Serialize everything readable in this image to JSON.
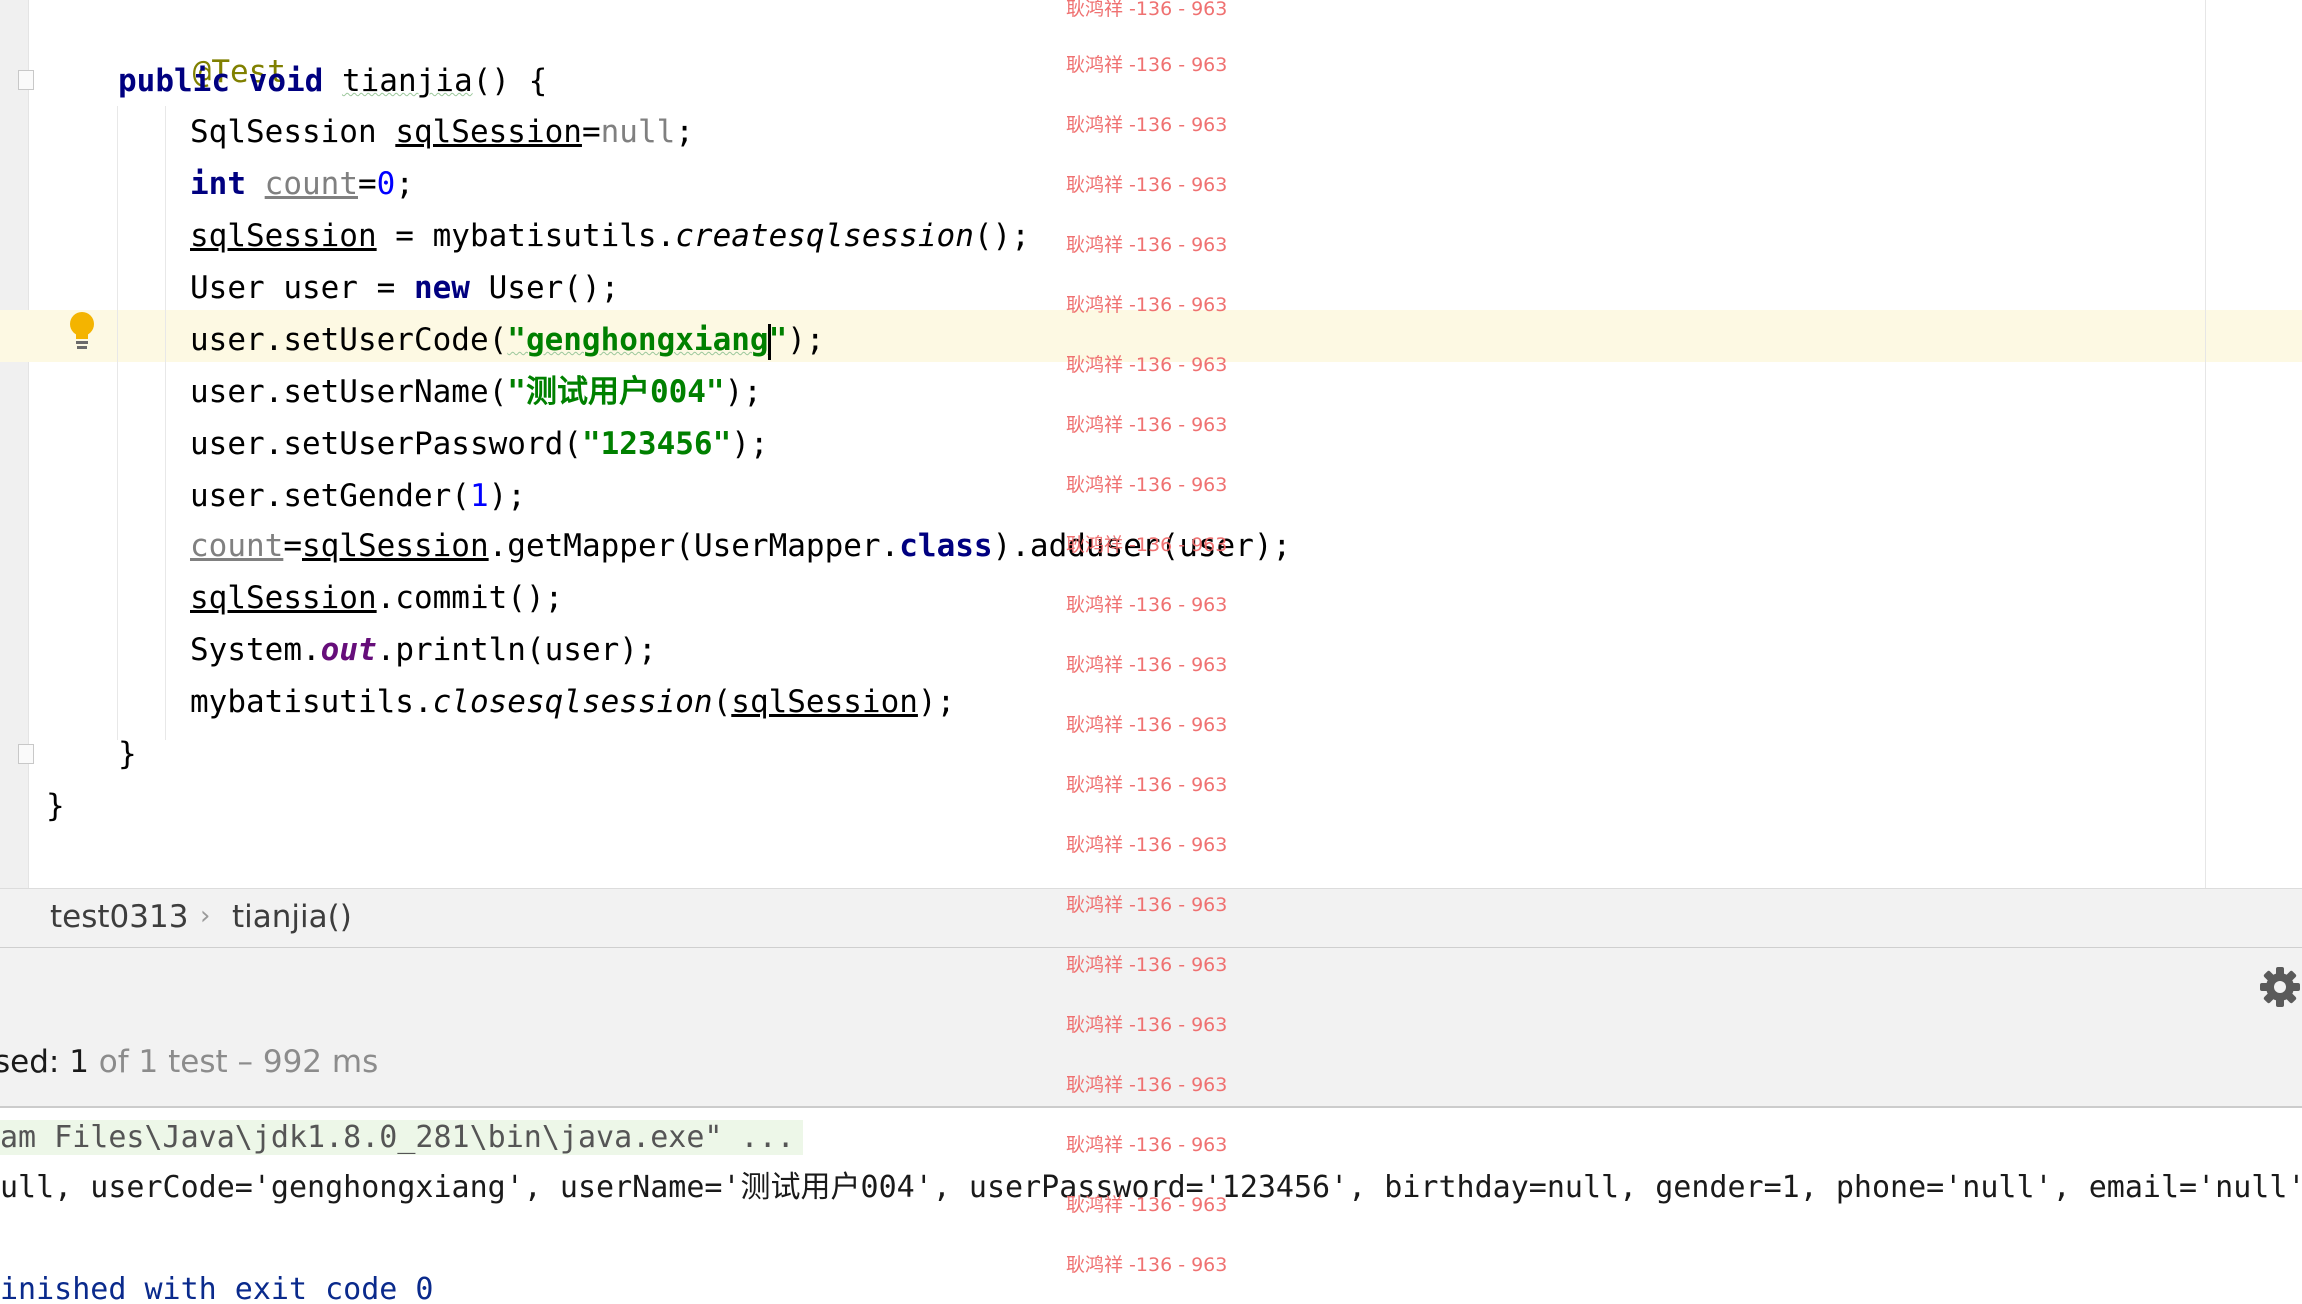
{
  "editor": {
    "lines": [
      {
        "annotation": "@Test"
      },
      {
        "k1": "public",
        "k2": "void",
        "method": "tianjia",
        "rest": "() {"
      },
      {
        "type": "SqlSession",
        "var": "sqlSession",
        "eq": "=",
        "null": "null",
        "end": ";"
      },
      {
        "kw": "int",
        "var": "count",
        "eq": "=",
        "num": "0",
        "end": ";"
      },
      {
        "var": "sqlSession",
        "mid": " = mybatisutils.",
        "method": "createsqlsession",
        "end": "();"
      },
      {
        "pre": "User user = ",
        "kw": "new",
        "post": " User();"
      },
      {
        "pre": "user.setUserCode(",
        "str": "\"genghongxiang",
        "str_end": "\"",
        "end": ");"
      },
      {
        "pre": "user.setUserName(",
        "str": "\"测试用户004\"",
        "end": ");"
      },
      {
        "pre": "user.setUserPassword(",
        "str": "\"123456\"",
        "end": ");"
      },
      {
        "pre": "user.setGender(",
        "num": "1",
        "end": ");"
      },
      {
        "var": "count",
        "eq": "=",
        "var2": "sqlSession",
        "mid": ".getMapper(UserMapper.",
        "kw": "class",
        "end": ").adduser(user);"
      },
      {
        "var": "sqlSession",
        "end": ".commit();"
      },
      {
        "pre": "System.",
        "field": "out",
        "end": ".println(user);"
      },
      {
        "pre": "mybatisutils.",
        "method": "closesqlsession",
        "paren": "(",
        "var": "sqlSession",
        "end": ");"
      },
      {
        "text": "}"
      },
      {
        "text": "}"
      }
    ]
  },
  "breadcrumb": {
    "class_name": "test0313",
    "separator": "›",
    "method_name": "tianjia()"
  },
  "test_status": {
    "passed_label": "sed: 1",
    "rest": " of 1 test – 992 ms"
  },
  "console": {
    "command": "am Files\\Java\\jdk1.8.0_281\\bin\\java.exe\" ...",
    "output": "ull, userCode='genghongxiang', userName='测试用户004', userPassword='123456', birthday=null, gender=1, phone='null', email='null'",
    "exit": "inished with exit code 0"
  },
  "watermark": {
    "text": "耿鸿祥 -136 - 963"
  },
  "icons": {
    "bulb": "lightbulb-icon",
    "settings": "gear-icon",
    "fold": "fold-marker-icon"
  },
  "colors": {
    "keyword": "#000080",
    "string": "#008000",
    "annotation": "#808000",
    "number": "#0000ff",
    "field": "#660e7a",
    "highlight_line": "#fdf9e3",
    "watermark": "#ef6a6a"
  }
}
